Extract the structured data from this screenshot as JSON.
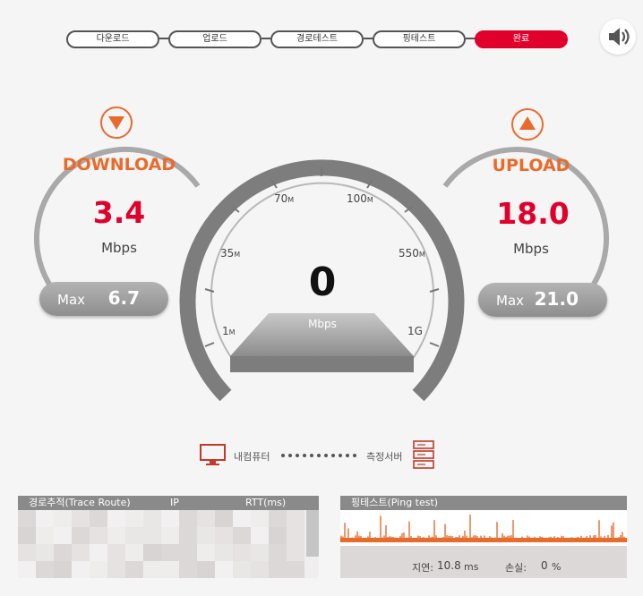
{
  "steps": [
    "다운로드",
    "업로드",
    "경로테스트",
    "핑테스트",
    "완료"
  ],
  "active_step": 4,
  "sound_icon": "speaker-icon",
  "download": {
    "title": "DOWNLOAD",
    "value": "3.4",
    "unit": "Mbps",
    "max_label": "Max",
    "max_value": "6.7",
    "icon": "arrow-down-icon"
  },
  "upload": {
    "title": "UPLOAD",
    "value": "18.0",
    "unit": "Mbps",
    "max_label": "Max",
    "max_value": "21.0",
    "icon": "arrow-up-icon"
  },
  "gauge": {
    "value": "0",
    "unit": "Mbps",
    "scale": [
      {
        "num": "1",
        "suffix": "M"
      },
      {
        "num": "35",
        "suffix": "M"
      },
      {
        "num": "70",
        "suffix": "M"
      },
      {
        "num": "100",
        "suffix": "M"
      },
      {
        "num": "550",
        "suffix": "M"
      },
      {
        "num": "1G",
        "suffix": ""
      }
    ]
  },
  "route": {
    "from": "내컴퓨터",
    "to": "측정서버",
    "from_icon": "monitor-icon",
    "to_icon": "server-icon"
  },
  "trace": {
    "headers": [
      "경로추적(Trace Route)",
      "IP",
      "RTT(ms)"
    ]
  },
  "ping": {
    "title": "핑테스트(Ping test)",
    "latency_label": "지연:",
    "latency_value": "10.8",
    "latency_unit": "ms",
    "loss_label": "손실:",
    "loss_value": "0",
    "loss_unit": "%"
  },
  "colors": {
    "accent_red": "#e0002b",
    "accent_orange": "#ea6a2b",
    "ring_gray": "#a9a9a9",
    "dark_gray": "#7d7d7d"
  }
}
